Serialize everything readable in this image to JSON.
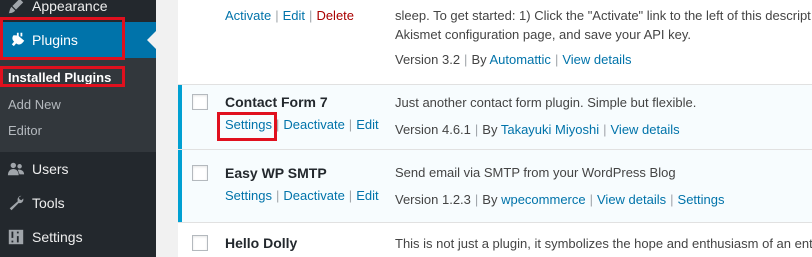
{
  "sidebar": {
    "appearance": "Appearance",
    "plugins": "Plugins",
    "submenu": {
      "installed": "Installed Plugins",
      "add_new": "Add New",
      "editor": "Editor"
    },
    "users": "Users",
    "tools": "Tools",
    "settings": "Settings"
  },
  "plugins": {
    "akismet": {
      "actions": {
        "activate": "Activate",
        "edit": "Edit",
        "delete": "Delete"
      },
      "desc_line1": "sleep. To get started: 1) Click the \"Activate\" link to the left of this descript",
      "desc_line2": "Akismet configuration page, and save your API key.",
      "version": "Version 3.2",
      "by": "By",
      "author": "Automattic",
      "view_details": "View details"
    },
    "contact_form": {
      "name": "Contact Form 7",
      "actions": {
        "settings": "Settings",
        "deactivate": "Deactivate",
        "edit": "Edit"
      },
      "desc": "Just another contact form plugin. Simple but flexible.",
      "version": "Version 4.6.1",
      "by": "By",
      "author": "Takayuki Miyoshi",
      "view_details": "View details"
    },
    "easy_wp_smtp": {
      "name": "Easy WP SMTP",
      "actions": {
        "settings": "Settings",
        "deactivate": "Deactivate",
        "edit": "Edit"
      },
      "desc": "Send email via SMTP from your WordPress Blog",
      "version": "Version 1.2.3",
      "by": "By",
      "author": "wpecommerce",
      "view_details": "View details",
      "settings_link": "Settings"
    },
    "hello_dolly": {
      "name": "Hello Dolly",
      "desc": "This is not just a plugin, it symbolizes the hope and enthusiasm of an entire"
    }
  },
  "colors": {
    "sidebar_bg": "#23282d",
    "submenu_bg": "#32373c",
    "active_menu": "#0073aa",
    "link": "#0073aa",
    "active_border": "#00a0d2",
    "highlight": "#e0101e"
  },
  "icons": {
    "appearance": "paintbrush-icon",
    "plugins": "plug-icon",
    "users": "users-icon",
    "tools": "wrench-icon",
    "settings": "settings-sliders-icon"
  }
}
